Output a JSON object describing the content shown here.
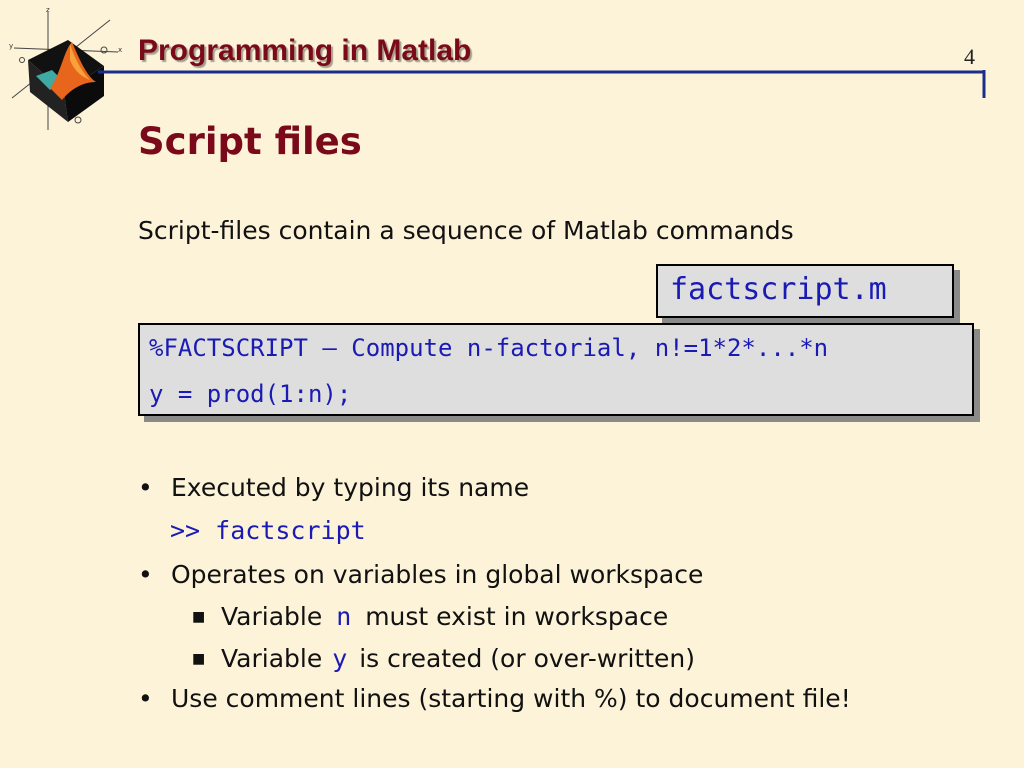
{
  "header": {
    "title": "Programming in Matlab",
    "page_number": "4"
  },
  "slide": {
    "title": "Script files",
    "intro": "Script-files contain a sequence of Matlab commands",
    "filename": "factscript.m",
    "code": [
      "%FACTSCRIPT – Compute n-factorial, n!=1*2*...*n",
      "y = prod(1:n);"
    ],
    "bullets": {
      "b1": "Executed by typing its name",
      "command": ">> factscript",
      "b2": "Operates on variables in global workspace",
      "sub1": {
        "pre": "Variable",
        "var": "n",
        "post": "must exist in workspace"
      },
      "sub2": {
        "pre": "Variable",
        "var": "y",
        "post": "is created (or over-written)"
      },
      "b3": "Use comment lines (starting with %) to document file!"
    }
  },
  "logo": {
    "axis_x": "x",
    "axis_y": "y",
    "axis_z": "z"
  }
}
